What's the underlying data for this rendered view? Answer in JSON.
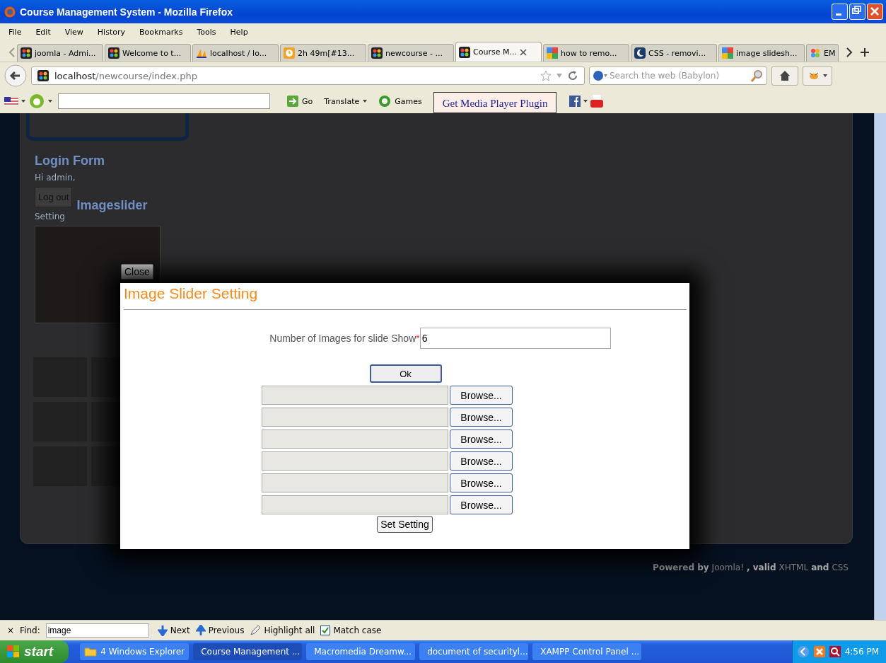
{
  "window": {
    "title": "Course Management System - Mozilla Firefox"
  },
  "menu": [
    "File",
    "Edit",
    "View",
    "History",
    "Bookmarks",
    "Tools",
    "Help"
  ],
  "tabs": [
    {
      "label": "joomla - Admi...",
      "selected": false
    },
    {
      "label": "Welcome to t...",
      "selected": false
    },
    {
      "label": "localhost / lo...",
      "selected": false
    },
    {
      "label": "2h 49m[#13...",
      "selected": false
    },
    {
      "label": "newcourse - ...",
      "selected": false
    },
    {
      "label": "Course M...",
      "selected": true
    },
    {
      "label": "how to remo...",
      "selected": false
    },
    {
      "label": "CSS - removi...",
      "selected": false
    },
    {
      "label": "image slidesh...",
      "selected": false
    },
    {
      "label": "EM",
      "selected": false
    }
  ],
  "address": {
    "host": "localhost",
    "path": "/newcourse/index.php"
  },
  "search": {
    "placeholder": "Search the web (Babylon)"
  },
  "toolbar": {
    "go": "Go",
    "translate": "Translate",
    "games": "Games",
    "plugin": "Get Media Player Plugin"
  },
  "page": {
    "login_title": "Login Form",
    "greeting": "Hi admin,",
    "logout": "Log out",
    "slider_title": "Imageslider",
    "setting_link": "Setting",
    "footer": [
      {
        "kind": "text",
        "text": "Powered by"
      },
      {
        "kind": "link",
        "text": "Joomla!"
      },
      {
        "kind": "text",
        "text": ", valid"
      },
      {
        "kind": "link",
        "text": "XHTML"
      },
      {
        "kind": "text",
        "text": "and"
      },
      {
        "kind": "link",
        "text": "CSS"
      }
    ]
  },
  "dialog": {
    "close": "Close",
    "title": "Image Slider Setting",
    "count_label": "Number of Images for slide Show",
    "required": "*",
    "count_value": "6",
    "ok": "Ok",
    "files": [
      {
        "button": "Browse..."
      },
      {
        "button": "Browse..."
      },
      {
        "button": "Browse..."
      },
      {
        "button": "Browse..."
      },
      {
        "button": "Browse..."
      },
      {
        "button": "Browse..."
      }
    ],
    "submit": "Set Setting"
  },
  "find_bar": {
    "close": "×",
    "label": "Find:",
    "value": "image",
    "next": "Next",
    "previous": "Previous",
    "highlight": "Highlight all",
    "match_case": "Match case",
    "match_checked": true
  },
  "taskbar": {
    "start": "start",
    "items": [
      {
        "label": "4 Windows Explorer",
        "selected": false
      },
      {
        "label": "Course Management ...",
        "selected": true
      },
      {
        "label": "Macromedia Dreamw...",
        "selected": false
      },
      {
        "label": "document of securityl...",
        "selected": false
      },
      {
        "label": "XAMPP Control Panel ...",
        "selected": false
      }
    ],
    "clock": "4:56 PM"
  }
}
